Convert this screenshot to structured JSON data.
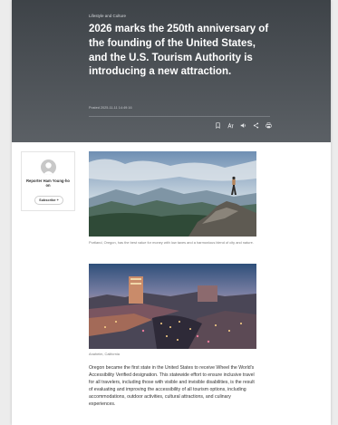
{
  "article": {
    "category": "Lifestyle and Culture",
    "headline": "2026 marks the 250th anniversary of the founding of the United States, and the U.S. Tourism Authority is introducing a new attraction.",
    "posted": "Posted 2025-11-11 14:49:16"
  },
  "header_icons": [
    "bookmark-icon",
    "font-size-icon",
    "audio-icon",
    "share-icon",
    "print-icon"
  ],
  "reporter": {
    "name": "Reporter Ham Young-ho on",
    "subscribe_label": "Subscribe +"
  },
  "figures": [
    {
      "caption": "Portland, Oregon, has the best value for money with low taxes and a harmonious blend of city and nature."
    },
    {
      "caption": "Anaheim, California"
    }
  ],
  "body": {
    "paragraph": "Oregon became the first state in the United States to receive Wheel the World's Accessibility Verified designation. This statewide effort to ensure inclusive travel for all travelers, including those with visible and invisible disabilities, is the result of evaluating and improving the accessibility of all tourism options, including accommodations, outdoor activities, cultural attractions, and culinary experiences."
  },
  "colors": {
    "header_top": "#3e4348",
    "header_bottom": "#5b6065",
    "headline_text": "#ffffff",
    "page_background": "#ececec"
  }
}
